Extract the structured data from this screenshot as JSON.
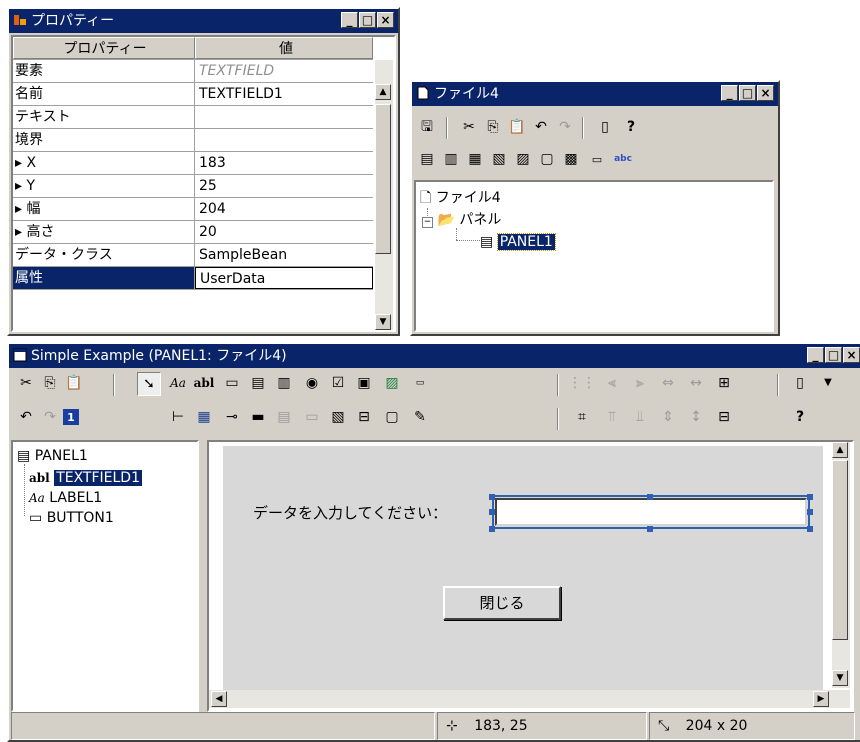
{
  "properties_window": {
    "title": "プロパティー",
    "header": {
      "name": "プロパティー",
      "value": "値"
    },
    "rows": [
      {
        "name": "要素",
        "value": "TEXTFIELD"
      },
      {
        "name": "名前",
        "value": "TEXTFIELD1"
      },
      {
        "name": "テキスト",
        "value": ""
      },
      {
        "name": "境界",
        "value": ""
      },
      {
        "name": "▸ X",
        "value": "183"
      },
      {
        "name": "▸ Y",
        "value": "25"
      },
      {
        "name": "▸ 幅",
        "value": "204"
      },
      {
        "name": "▸ 高さ",
        "value": "20"
      },
      {
        "name": "データ・クラス",
        "value": "SampleBean"
      },
      {
        "name": "属性",
        "value": "UserData"
      }
    ]
  },
  "file_window": {
    "title": "ファイル4",
    "tree": {
      "root": "ファイル4",
      "folder": "パネル",
      "panel": "PANEL1"
    }
  },
  "main_window": {
    "title": "Simple Example (PANEL1: ファイル4)",
    "tree": {
      "root": "PANEL1",
      "items": [
        "TEXTFIELD1",
        "LABEL1",
        "BUTTON1"
      ]
    },
    "canvas": {
      "label": "データを入力してください：",
      "button": "閉じる"
    },
    "status": {
      "position": "183, 25",
      "size": "204 x 20"
    }
  },
  "colors": {
    "title_bar": "#0a246a",
    "face": "#d4d0c8",
    "selection": "#0a246a",
    "canvas": "#d8d8d8"
  }
}
